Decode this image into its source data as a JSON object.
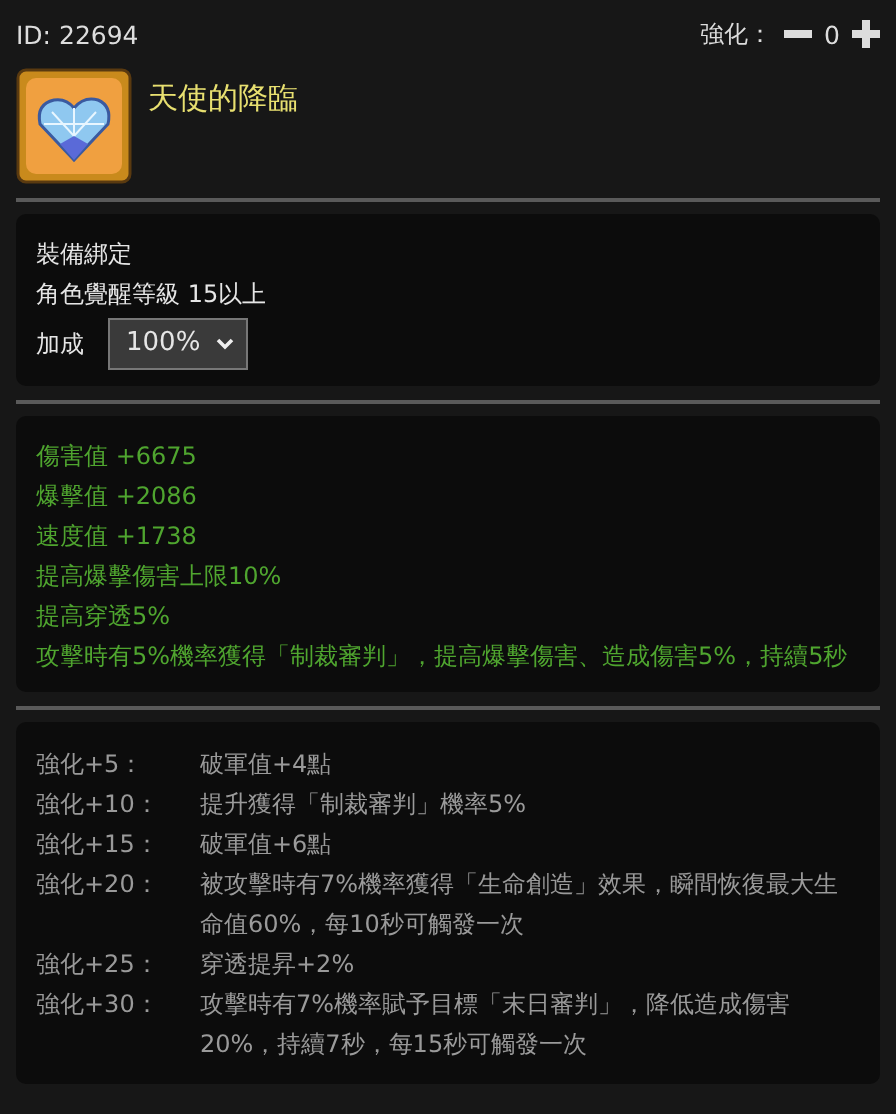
{
  "header": {
    "id": "ID: 22694",
    "enhance_label": "強化：",
    "enhance_value": "0"
  },
  "item": {
    "name": "天使的降臨"
  },
  "info": {
    "binding": "裝備綁定",
    "requirement": "角色覺醒等級 15以上",
    "bonus_label": "加成",
    "bonus_value": "100%"
  },
  "stats": [
    "傷害值 +6675",
    "爆擊值 +2086",
    "速度值 +1738",
    "提高爆擊傷害上限10%",
    "提高穿透5%",
    "攻擊時有5%機率獲得「制裁審判」，提高爆擊傷害、造成傷害5%，持續5秒"
  ],
  "enhancements": [
    {
      "level": "強化+5：",
      "effect": "破軍值+4點"
    },
    {
      "level": "強化+10：",
      "effect": "提升獲得「制裁審判」機率5%"
    },
    {
      "level": "強化+15：",
      "effect": "破軍值+6點"
    },
    {
      "level": "強化+20：",
      "effect": "被攻擊時有7%機率獲得「生命創造」效果，瞬間恢復最大生命值60%，每10秒可觸發一次"
    },
    {
      "level": "強化+25：",
      "effect": "穿透提昇+2%"
    },
    {
      "level": "強化+30：",
      "effect": "攻擊時有7%機率賦予目標「末日審判」，降低造成傷害20%，持續7秒，每15秒可觸發一次"
    }
  ]
}
